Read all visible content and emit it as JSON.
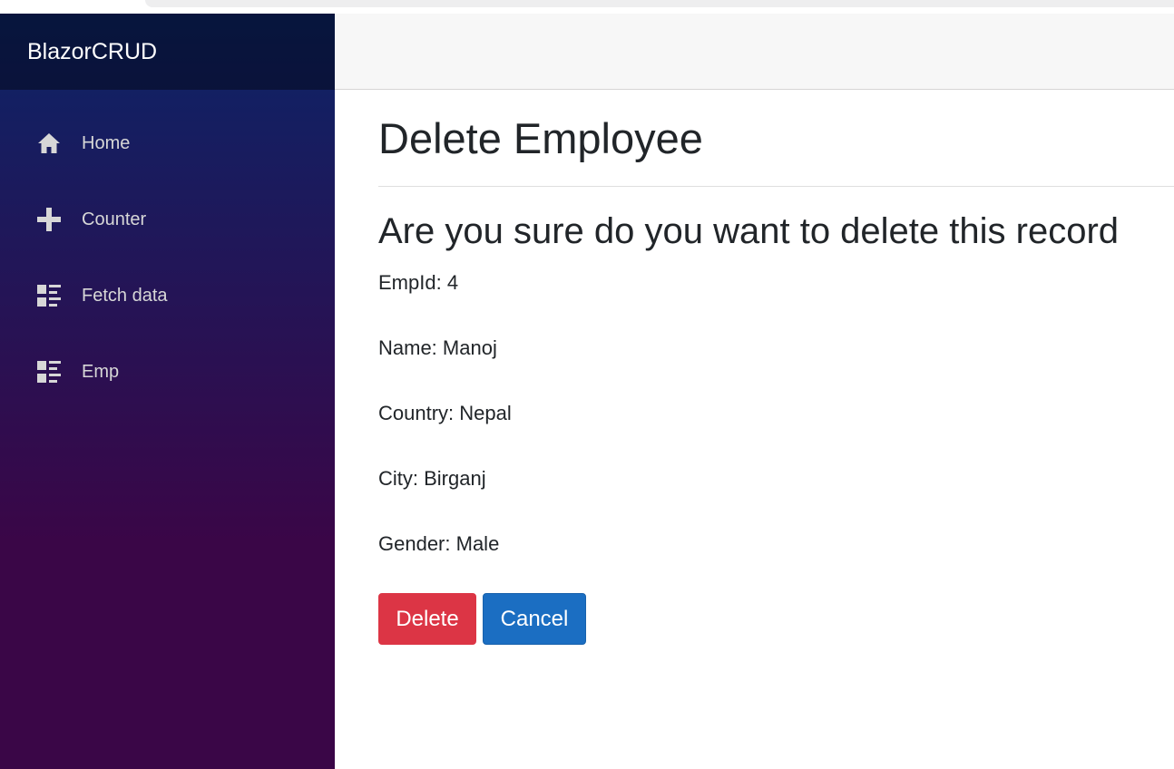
{
  "app": {
    "brand": "BlazorCRUD"
  },
  "sidebar": {
    "items": [
      {
        "label": "Home",
        "icon": "home-icon"
      },
      {
        "label": "Counter",
        "icon": "plus-icon"
      },
      {
        "label": "Fetch data",
        "icon": "list-rich-icon"
      },
      {
        "label": "Emp",
        "icon": "list-rich-icon"
      }
    ]
  },
  "main": {
    "title": "Delete Employee",
    "confirm_text": "Are you sure do you want to delete this record",
    "fields": [
      {
        "label": "EmpId:",
        "value": "4"
      },
      {
        "label": "Name:",
        "value": "Manoj"
      },
      {
        "label": "Country:",
        "value": "Nepal"
      },
      {
        "label": "City:",
        "value": "Birganj"
      },
      {
        "label": "Gender:",
        "value": "Male"
      }
    ],
    "buttons": {
      "delete_label": "Delete",
      "cancel_label": "Cancel"
    }
  },
  "colors": {
    "sidebar_top": "#0c2467",
    "sidebar_bottom": "#3a0647",
    "delete": "#dc3545",
    "cancel": "#1b6ec2"
  }
}
